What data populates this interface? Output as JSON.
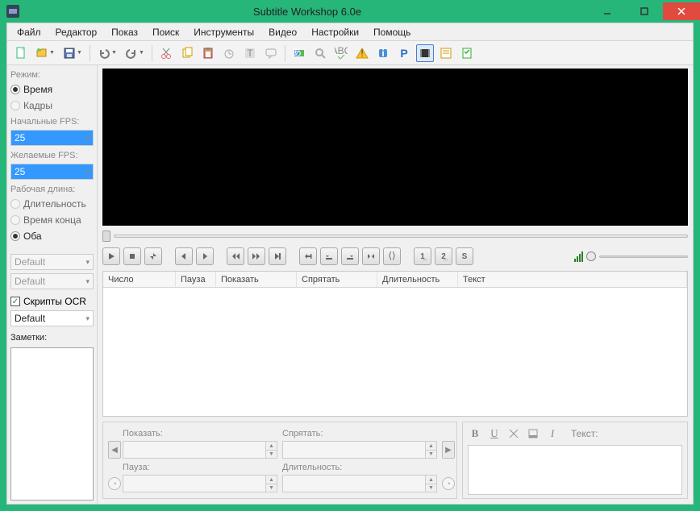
{
  "title": "Subtitle Workshop 6.0e",
  "menu": [
    "Файл",
    "Редактор",
    "Показ",
    "Поиск",
    "Инструменты",
    "Видео",
    "Настройки",
    "Помощь"
  ],
  "sidebar": {
    "mode_label": "Режим:",
    "mode_time": "Время",
    "mode_frames": "Кадры",
    "initial_fps_label": "Начальные FPS:",
    "initial_fps_value": "25",
    "desired_fps_label": "Желаемые FPS:",
    "desired_fps_value": "25",
    "worklen_label": "Рабочая длина:",
    "worklen_duration": "Длительность",
    "worklen_endtime": "Время конца",
    "worklen_both": "Оба",
    "default1": "Default",
    "default2": "Default",
    "ocr_label": "Скрипты OCR",
    "ocr_value": "Default",
    "notes_label": "Заметки:"
  },
  "grid": {
    "cols": [
      "Число",
      "Пауза",
      "Показать",
      "Спрятать",
      "Длительность",
      "Текст"
    ]
  },
  "editor": {
    "show": "Показать:",
    "hide": "Спрятать:",
    "pause": "Пауза:",
    "duration": "Длительность:",
    "text": "Текст:",
    "b": "B",
    "u": "U",
    "i": "I"
  }
}
